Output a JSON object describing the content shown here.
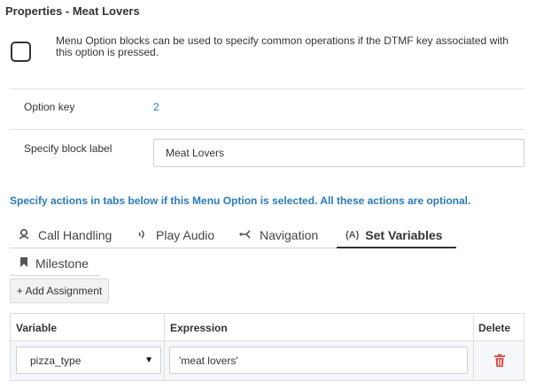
{
  "panel": {
    "title": "Properties - Meat Lovers",
    "description": "Menu Option blocks can be used to specify common operations if the DTMF key associated with this option is pressed."
  },
  "fields": {
    "option_key_label": "Option key",
    "option_key_value": "2",
    "block_label_label": "Specify block label",
    "block_label_value": "Meat Lovers"
  },
  "hint": "Specify actions in tabs below if this Menu Option is selected. All these actions are optional.",
  "tabs": [
    {
      "label": "Call Handling",
      "icon": "call-handling-icon",
      "active": false
    },
    {
      "label": "Play Audio",
      "icon": "audio-icon",
      "active": false
    },
    {
      "label": "Navigation",
      "icon": "navigation-icon",
      "active": false
    },
    {
      "label": "Set Variables",
      "icon": "variable-icon",
      "active": true
    },
    {
      "label": "Milestone",
      "icon": "bookmark-icon",
      "active": false
    }
  ],
  "tab_icons": {
    "variables_glyph": "(A)"
  },
  "add_assignment_label": "+ Add Assignment",
  "table": {
    "headers": [
      "Variable",
      "Expression",
      "Delete"
    ],
    "rows": [
      {
        "variable": "pizza_type",
        "expression": "'meat lovers'"
      }
    ]
  },
  "colors": {
    "accent": "#2a7ab8",
    "delete": "#d9534f"
  }
}
